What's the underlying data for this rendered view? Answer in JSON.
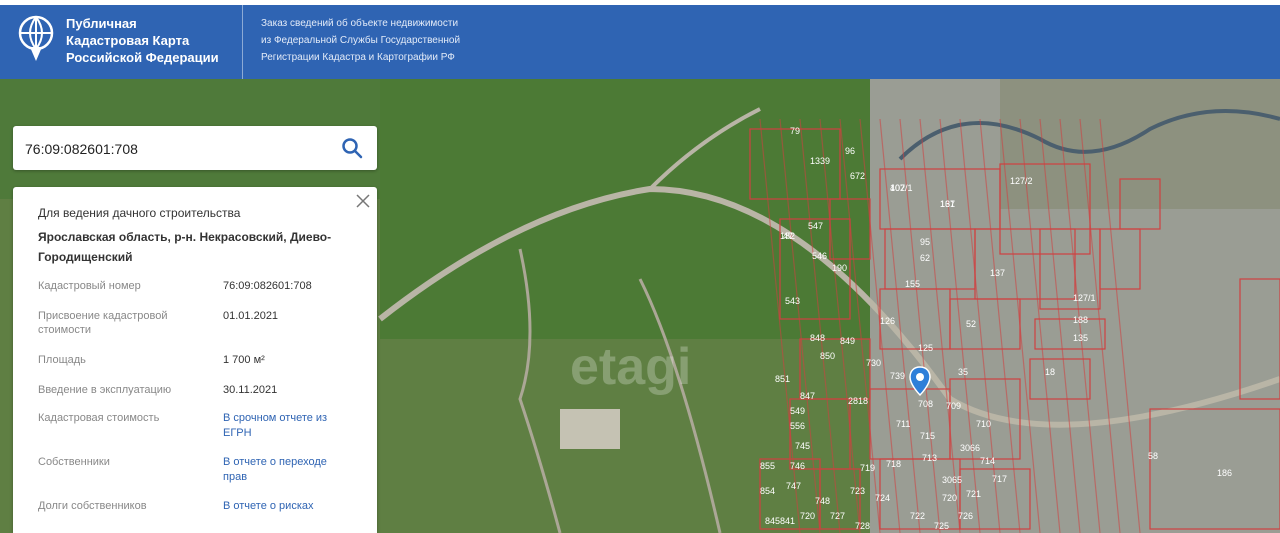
{
  "header": {
    "brand_line1": "Публичная",
    "brand_line2": "Кадастровая Карта",
    "brand_line3": "Российской Федерации",
    "sub_line1": "Заказ сведений об объекте недвижимости",
    "sub_line2": "из Федеральной Службы Государственной",
    "sub_line3": "Регистрации Кадастра и Картографии РФ",
    "logo_icon": "globe-icon"
  },
  "search": {
    "value": "76:09:082601:708",
    "icon": "search-icon"
  },
  "card": {
    "purpose": "Для ведения дачного строительства",
    "address": "Ярославская область, р-н. Некрасовский, Диево-Городищенский",
    "rows": [
      {
        "label": "Кадастровый номер",
        "value": "76:09:082601:708"
      },
      {
        "label": "Присвоение кадастровой стоимости",
        "value": "01.01.2021"
      },
      {
        "label": "Площадь",
        "value": "1 700 м²"
      },
      {
        "label": "Введение в эксплуатацию",
        "value": "30.11.2021"
      },
      {
        "label": "Кадастровая стоимость",
        "value": "В срочном отчете из ЕГРН"
      },
      {
        "label": "Собственники",
        "value": "В отчете о переходе прав"
      },
      {
        "label": "Долги собственников",
        "value": "В отчете о рисках"
      }
    ]
  },
  "map": {
    "parcel_labels": [
      "402/1",
      "161",
      "127/2",
      "95",
      "62",
      "137",
      "155",
      "126",
      "125",
      "52",
      "35",
      "709",
      "710",
      "715",
      "3066",
      "713",
      "714",
      "3065",
      "717",
      "718",
      "720",
      "721",
      "722",
      "725",
      "726",
      "727",
      "728",
      "723",
      "724",
      "719",
      "711",
      "730",
      "739",
      "708",
      "2818",
      "851",
      "850",
      "849",
      "848",
      "847",
      "745",
      "746",
      "747",
      "748",
      "720",
      "841",
      "845",
      "854",
      "855",
      "556",
      "549",
      "543",
      "546",
      "547",
      "190",
      "182",
      "188",
      "135",
      "127/1",
      "18",
      "58",
      "186",
      "672",
      "1339",
      "96",
      "79",
      "47",
      "107",
      "137"
    ],
    "colors": {
      "header": "#2f64b3",
      "parcel": "#d04040",
      "link": "#2f64b3",
      "marker": "#2e7fd9"
    },
    "marker_icon": "location-pin-icon",
    "watermark": "etagi"
  }
}
